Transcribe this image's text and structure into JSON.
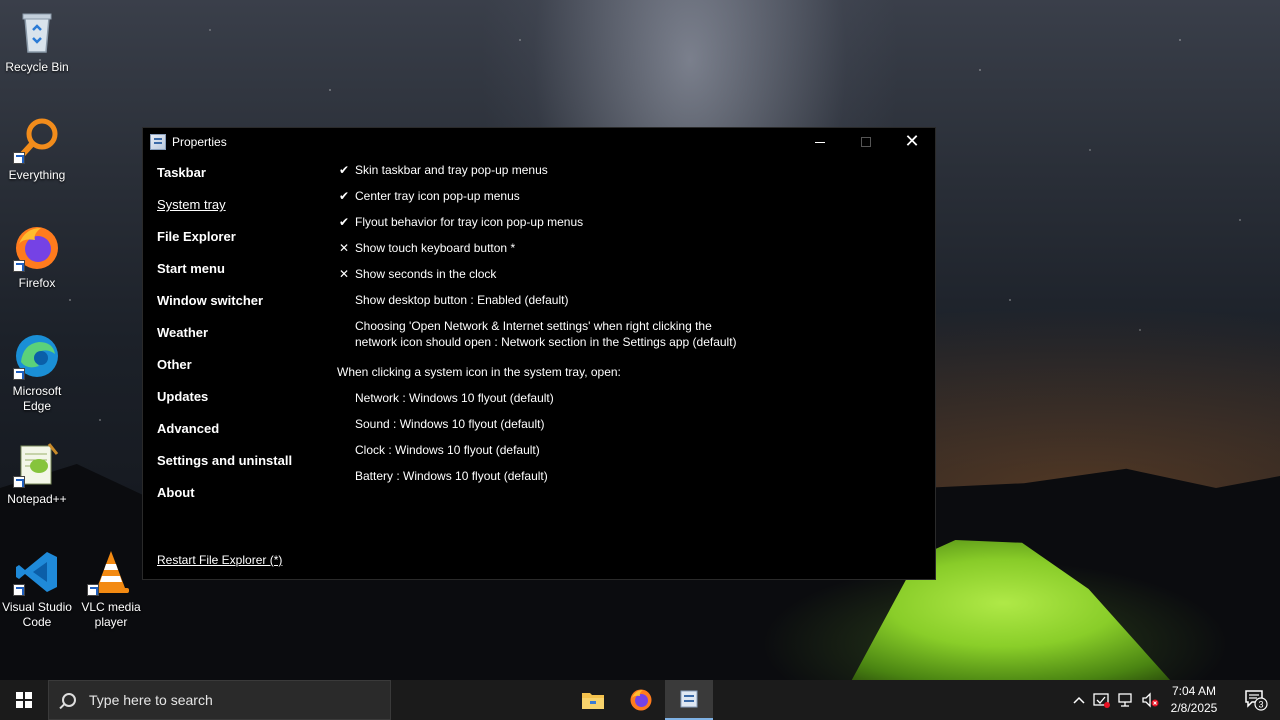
{
  "desktop": {
    "icons": [
      {
        "label": "Recycle Bin",
        "icon": "recycle-bin-icon"
      },
      {
        "label": "Everything",
        "icon": "everything-search-icon"
      },
      {
        "label": "Firefox",
        "icon": "firefox-icon"
      },
      {
        "label": "Microsoft Edge",
        "icon": "edge-icon"
      },
      {
        "label": "Notepad++",
        "icon": "notepadpp-icon"
      },
      {
        "label": "Visual Studio Code",
        "icon": "vscode-icon"
      },
      {
        "label": "VLC media player",
        "icon": "vlc-icon"
      }
    ]
  },
  "window": {
    "title": "Properties",
    "nav": [
      {
        "label": "Taskbar",
        "active": false
      },
      {
        "label": "System tray",
        "active": true
      },
      {
        "label": "File Explorer",
        "active": false
      },
      {
        "label": "Start menu",
        "active": false
      },
      {
        "label": "Window switcher",
        "active": false
      },
      {
        "label": "Weather",
        "active": false
      },
      {
        "label": "Other",
        "active": false
      },
      {
        "label": "Updates",
        "active": false
      },
      {
        "label": "Advanced",
        "active": false
      },
      {
        "label": "Settings and uninstall",
        "active": false
      },
      {
        "label": "About",
        "active": false
      }
    ],
    "restart_link": "Restart File Explorer (*)",
    "options": [
      {
        "mark": "✔",
        "label": "Skin taskbar and tray pop-up menus"
      },
      {
        "mark": "✔",
        "label": "Center tray icon pop-up menus"
      },
      {
        "mark": "✔",
        "label": "Flyout behavior for tray icon pop-up menus"
      },
      {
        "mark": "✕",
        "label": "Show touch keyboard button *"
      },
      {
        "mark": "✕",
        "label": "Show seconds in the clock"
      },
      {
        "mark": "",
        "label": "Show desktop button : Enabled (default)"
      },
      {
        "mark": "",
        "label": "Choosing 'Open Network & Internet settings' when right clicking the",
        "label2": "network icon should open : Network section in the Settings app (default)"
      }
    ],
    "system_icons_heading": "When clicking a system icon in the system tray, open:",
    "system_icons": [
      "Network : Windows 10 flyout (default)",
      "Sound : Windows 10 flyout (default)",
      "Clock : Windows 10 flyout (default)",
      "Battery : Windows 10 flyout (default)"
    ]
  },
  "taskbar": {
    "search_placeholder": "Type here to search",
    "clock_time": "7:04 AM",
    "clock_date": "2/8/2025",
    "notification_count": "3"
  }
}
